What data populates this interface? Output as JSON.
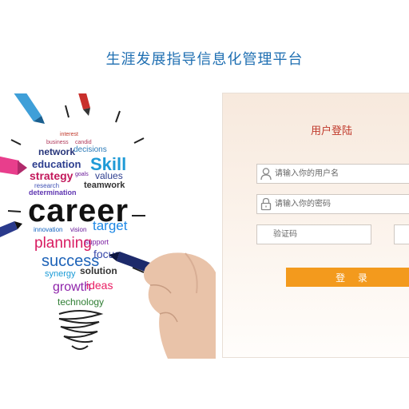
{
  "header": {
    "title": "生涯发展指导信息化管理平台"
  },
  "hero": {
    "words": {
      "interest": "interest",
      "business": "business",
      "candid": "candid",
      "network": "network",
      "decisions": "decisions",
      "education": "education",
      "skill": "Skill",
      "strategy": "strategy",
      "goals": "goals",
      "values": "values",
      "research": "research",
      "determination": "determination",
      "teamwork": "teamwork",
      "career": "career",
      "innovation": "innovation",
      "vision": "vision",
      "target": "target",
      "planning": "planning",
      "support": "support",
      "success": "success",
      "focus": "focus",
      "synergy": "synergy",
      "solution": "solution",
      "growth": "growth",
      "ideas": "ideas",
      "technology": "technology"
    }
  },
  "login": {
    "title": "用户登陆",
    "username": {
      "placeholder": "请输入你的用户名",
      "value": ""
    },
    "password": {
      "placeholder": "请输入你的密码",
      "value": ""
    },
    "captcha": {
      "placeholder": "验证码",
      "value": ""
    },
    "submit_label": "登 录"
  },
  "colors": {
    "title": "#1f6fb2",
    "accent_button": "#f39a1d",
    "login_title": "#c0392b"
  },
  "icons": {
    "user": "user-icon",
    "lock": "lock-icon"
  }
}
